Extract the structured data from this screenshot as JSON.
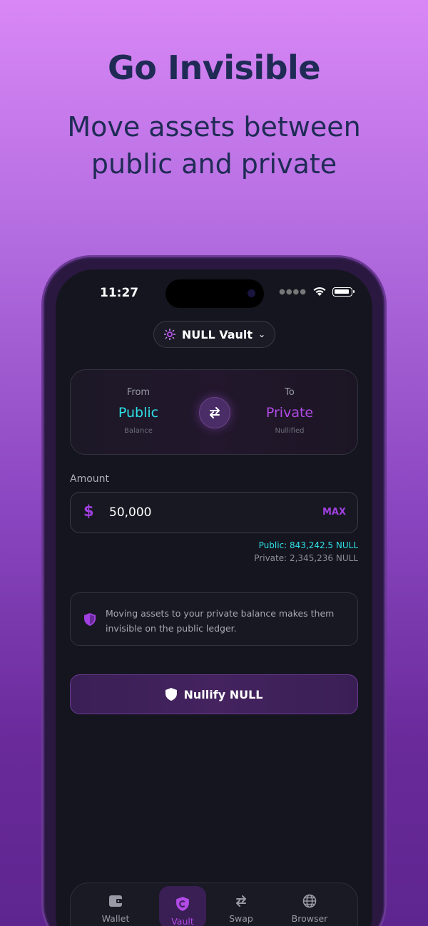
{
  "promo": {
    "headline": "Go Invisible",
    "subheadline": "Move assets between public and private"
  },
  "status_bar": {
    "time": "11:27"
  },
  "vault_selector": {
    "label": "NULL Vault"
  },
  "swap": {
    "from": {
      "label": "From",
      "value": "Public",
      "sub": "Balance"
    },
    "to": {
      "label": "To",
      "value": "Private",
      "sub": "Nullified"
    }
  },
  "amount": {
    "label": "Amount",
    "currency_symbol": "$",
    "value": "50,000",
    "max_label": "MAX"
  },
  "balances": {
    "public": "Public: 843,242.5 NULL",
    "private": "Private: 2,345,236 NULL"
  },
  "info": {
    "text": "Moving assets to your private balance makes them invisible on the public ledger."
  },
  "cta": {
    "label": "Nullify NULL"
  },
  "tabbar": {
    "items": [
      {
        "label": "Wallet",
        "icon": "wallet-icon",
        "active": false
      },
      {
        "label": "Vault",
        "icon": "vault-icon",
        "active": true
      },
      {
        "label": "Swap",
        "icon": "swap-icon",
        "active": false
      },
      {
        "label": "Browser",
        "icon": "globe-icon",
        "active": false
      }
    ]
  },
  "colors": {
    "public_accent": "#2ee0e6",
    "private_accent": "#b24ae6",
    "headline": "#1f2b55"
  }
}
